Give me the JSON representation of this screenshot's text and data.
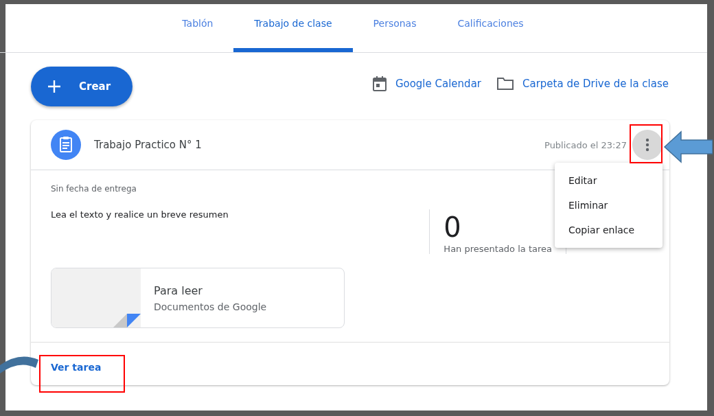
{
  "tabs": [
    {
      "label": "Tablón",
      "selected": false
    },
    {
      "label": "Trabajo de clase",
      "selected": true
    },
    {
      "label": "Personas",
      "selected": false
    },
    {
      "label": "Calificaciones",
      "selected": false
    }
  ],
  "create_button": {
    "label": "Crear"
  },
  "links": [
    {
      "kind": "calendar",
      "label": "Google Calendar"
    },
    {
      "kind": "folder",
      "label": "Carpeta de Drive de la clase"
    }
  ],
  "assignment": {
    "title": "Trabajo Practico N° 1",
    "posted": "Publicado el 23:27",
    "due": "Sin fecha de entrega",
    "description": "Lea el texto y realice un breve resumen",
    "stats": [
      {
        "count": "0",
        "label": "Han presentado la tarea"
      }
    ],
    "attachment": {
      "title": "Para leer",
      "type": "Documentos de Google"
    },
    "menu": {
      "open": true,
      "items": [
        "Editar",
        "Eliminar",
        "Copiar enlace"
      ]
    },
    "view_link": "Ver tarea"
  }
}
